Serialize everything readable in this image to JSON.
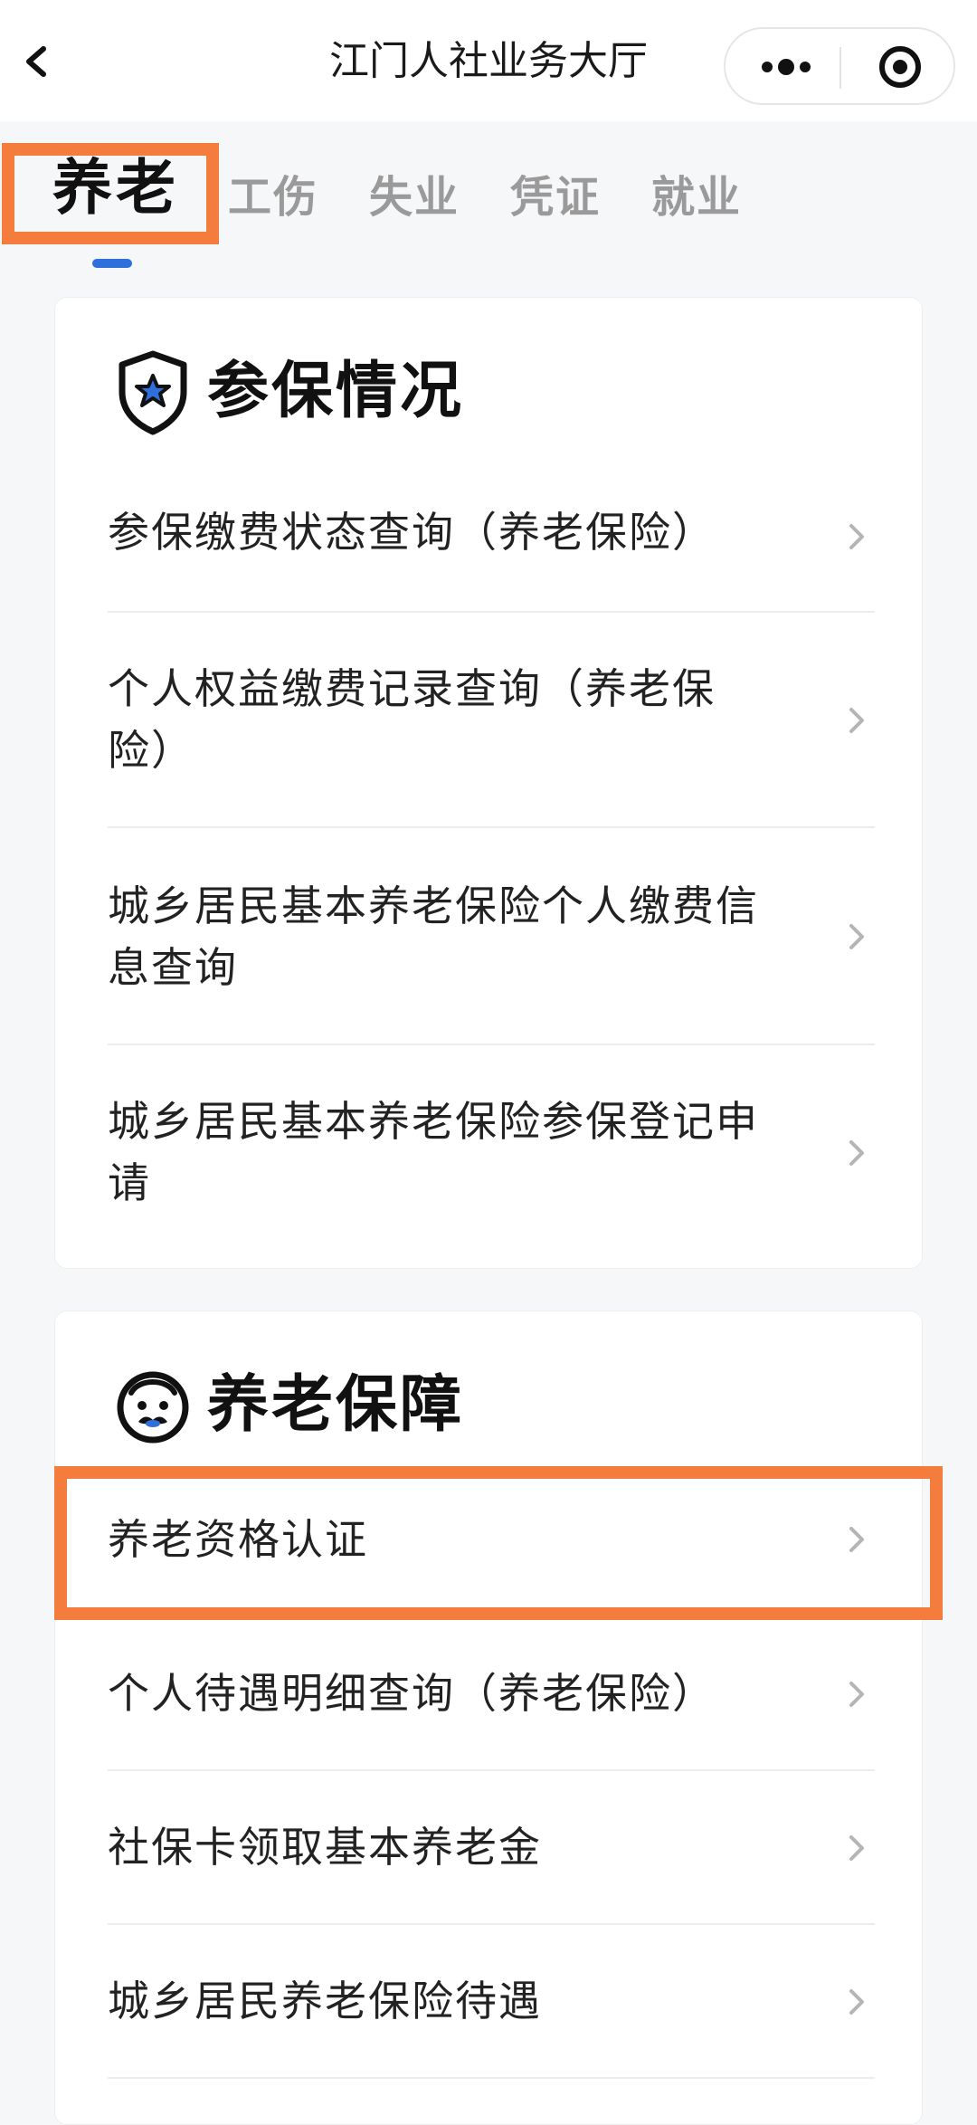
{
  "topbar": {
    "title": "江门人社业务大厅",
    "back_icon": "chevron-left-icon",
    "more_icon": "more-dots-icon",
    "close_icon": "target-close-icon"
  },
  "tabs": [
    {
      "label": "养老",
      "active": true
    },
    {
      "label": "工伤",
      "active": false
    },
    {
      "label": "失业",
      "active": false
    },
    {
      "label": "凭证",
      "active": false
    },
    {
      "label": "就业",
      "active": false
    }
  ],
  "sections": [
    {
      "title": "参保情况",
      "icon": "shield-star-icon",
      "items": [
        {
          "label": "参保缴费状态查询（养老保险）"
        },
        {
          "label": "个人权益缴费记录查询（养老保险）"
        },
        {
          "label": "城乡居民基本养老保险个人缴费信息查询"
        },
        {
          "label": "城乡居民基本养老保险参保登记申请"
        }
      ]
    },
    {
      "title": "养老保障",
      "icon": "elder-face-icon",
      "items": [
        {
          "label": "养老资格认证"
        },
        {
          "label": "个人待遇明细查询（养老保险）"
        },
        {
          "label": "社保卡领取基本养老金"
        },
        {
          "label": "城乡居民养老保险待遇"
        }
      ]
    }
  ],
  "colors": {
    "accent": "#2f6fdc",
    "highlight": "#f47c3c",
    "background": "#f6f7f9"
  }
}
